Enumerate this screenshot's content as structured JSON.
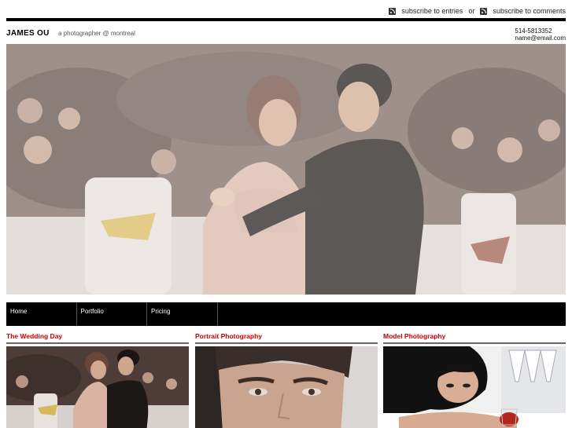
{
  "topbar": {
    "entries_link": "subscribe to entries",
    "separator": "or",
    "comments_link": "subscribe to comments",
    "icon": "rss-icon"
  },
  "header": {
    "name": "JAMES OU",
    "tagline": "a photographer @ montreal",
    "phone": "514-5813352",
    "email": "name@email.com"
  },
  "nav": {
    "items": [
      {
        "label": "Home"
      },
      {
        "label": "Portfolio"
      },
      {
        "label": "Pricing"
      }
    ]
  },
  "sections": [
    {
      "title": "The Wedding Day"
    },
    {
      "title": "Portrait Photography"
    },
    {
      "title": "Model Photography"
    }
  ],
  "colors": {
    "accent": "#cc0000",
    "nav_bg": "#000000",
    "rule": "#000000"
  }
}
